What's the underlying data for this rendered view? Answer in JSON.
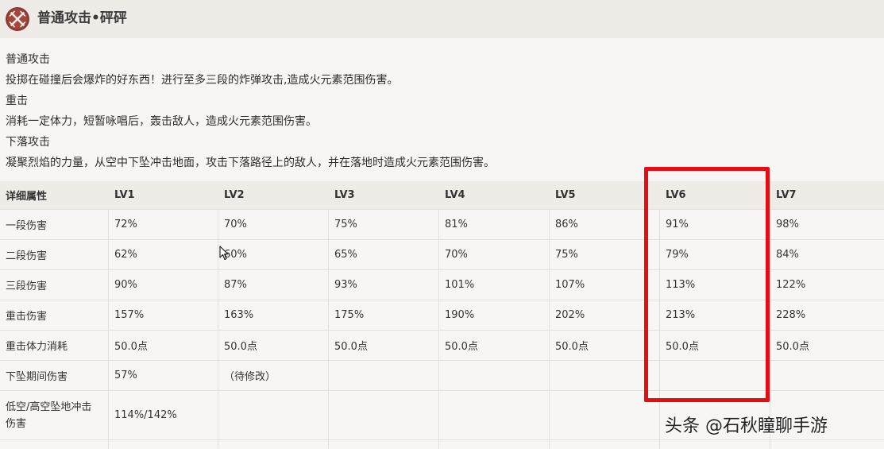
{
  "header": {
    "icon": "crossed-swords-icon",
    "title": "普通攻击•砰砰"
  },
  "description": [
    "普通攻击",
    "投掷在碰撞后会爆炸的好东西！进行至多三段的炸弹攻击,造成火元素范围伤害。",
    "重击",
    "消耗一定体力，短暂咏唱后，轰击敌人，造成火元素范围伤害。",
    "下落攻击",
    "凝聚烈焰的力量，从空中下坠冲击地面，攻击下落路径上的敌人，并在落地时造成火元素范围伤害。"
  ],
  "table": {
    "headers": [
      "详细属性",
      "LV1",
      "LV2",
      "LV3",
      "LV4",
      "LV5",
      "LV6",
      "LV7"
    ],
    "rows": [
      [
        "一段伤害",
        "72%",
        "70%",
        "75%",
        "81%",
        "86%",
        "91%",
        "98%"
      ],
      [
        "二段伤害",
        "62%",
        "60%",
        "65%",
        "70%",
        "75%",
        "79%",
        "84%"
      ],
      [
        "三段伤害",
        "90%",
        "87%",
        "93%",
        "101%",
        "107%",
        "113%",
        "122%"
      ],
      [
        "重击伤害",
        "157%",
        "163%",
        "175%",
        "190%",
        "202%",
        "213%",
        "228%"
      ],
      [
        "重击体力消耗",
        "50.0点",
        "50.0点",
        "50.0点",
        "50.0点",
        "50.0点",
        "50.0点",
        "50.0点"
      ],
      [
        "下坠期间伤害",
        "57%",
        "（待修改）",
        "",
        "",
        "",
        "",
        ""
      ],
      [
        "低空/高空坠地冲击伤害",
        "114%/142%",
        "",
        "",
        "",
        "",
        "",
        ""
      ]
    ]
  },
  "highlight": {
    "column": "LV6",
    "color": "#e40d12"
  },
  "watermark": "头条 @石秋瞳聊手游"
}
